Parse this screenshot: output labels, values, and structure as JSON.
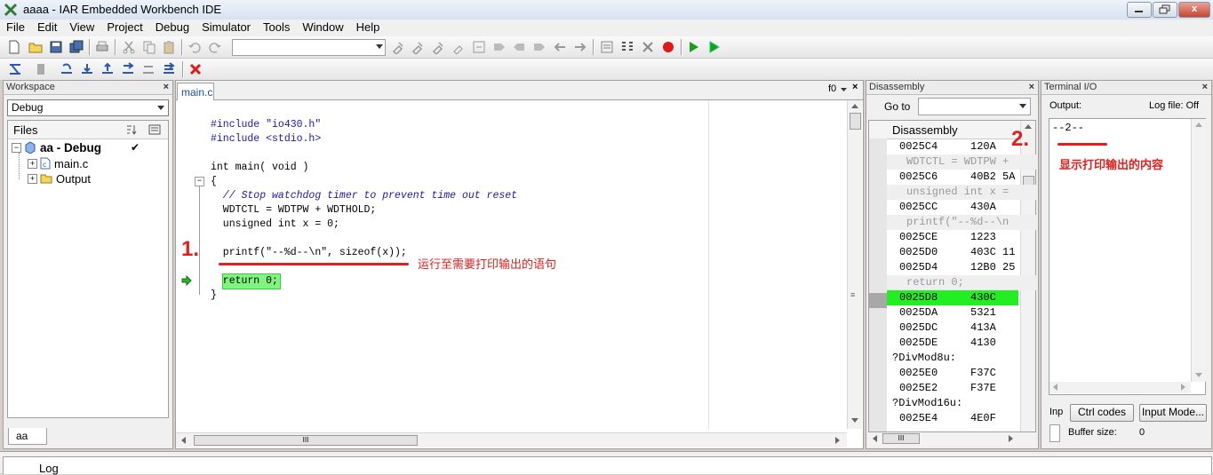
{
  "window": {
    "title": "aaaa - IAR Embedded Workbench IDE",
    "min_label": "",
    "max_label": "",
    "close_label": "x"
  },
  "menu": [
    "File",
    "Edit",
    "View",
    "Project",
    "Debug",
    "Simulator",
    "Tools",
    "Window",
    "Help"
  ],
  "workspace": {
    "header": "Workspace",
    "close": "×",
    "config": "Debug",
    "files_label": "Files",
    "project": "aa - Debug",
    "check": "✔",
    "file1": "main.c",
    "folder1": "Output",
    "bottom_tab": "aa"
  },
  "editor": {
    "tab": "main.c",
    "func_label": "f0",
    "code": [
      "#include \"io430.h\"",
      "#include <stdio.h>",
      "",
      "int main( void )",
      "{",
      "  // Stop watchdog timer to prevent time out reset",
      "  WDTCTL = WDTPW + WDTHOLD;",
      "  unsigned int x = 0;",
      "",
      "  printf(\"--%d--\\n\", sizeof(x));",
      "",
      "  return 0;",
      "}"
    ],
    "annotation1_num": "1.",
    "annotation1_text": "运行至需要打印输出的语句",
    "hscroll_thumb": "III"
  },
  "disassembly": {
    "header": "Disassembly",
    "goto_label": "Go to",
    "title": "Disassembly",
    "lines": [
      {
        "addr": "0025C4",
        "code": "120A",
        "type": "code"
      },
      {
        "text": "WDTCTL = WDTPW +",
        "type": "src"
      },
      {
        "addr": "0025C6",
        "code": "40B2 5A",
        "type": "code"
      },
      {
        "text": "unsigned int x =",
        "type": "src"
      },
      {
        "addr": "0025CC",
        "code": "430A",
        "type": "code"
      },
      {
        "text": "printf(\"--%d--\\n",
        "type": "src"
      },
      {
        "addr": "0025CE",
        "code": "1223",
        "type": "code"
      },
      {
        "addr": "0025D0",
        "code": "403C 11",
        "type": "code"
      },
      {
        "addr": "0025D4",
        "code": "12B0 25",
        "type": "code"
      },
      {
        "text": "return 0;",
        "type": "src"
      },
      {
        "addr": "0025D8",
        "code": "430C",
        "type": "cur"
      },
      {
        "addr": "0025DA",
        "code": "5321",
        "type": "code"
      },
      {
        "addr": "0025DC",
        "code": "413A",
        "type": "code"
      },
      {
        "addr": "0025DE",
        "code": "4130",
        "type": "code"
      },
      {
        "text": "?DivMod8u:",
        "type": "label"
      },
      {
        "addr": "0025E0",
        "code": "F37C",
        "type": "code"
      },
      {
        "addr": "0025E2",
        "code": "F37E",
        "type": "code"
      },
      {
        "text": "?DivMod16u:",
        "type": "label"
      },
      {
        "addr": "0025E4",
        "code": "4E0F",
        "type": "code"
      }
    ],
    "hscroll_thumb": "III",
    "annotation2_num": "2.",
    "annotation2_text": "显示打印输出的内容"
  },
  "terminal": {
    "header": "Terminal I/O",
    "output_label": "Output:",
    "logfile_label": "Log file:  Off",
    "output_text": "--2--",
    "input_label": "Inp",
    "ctrl_codes": "Ctrl codes",
    "input_mode": "Input Mode...",
    "buffer_label": "Buffer size:",
    "buffer_value": "0"
  },
  "log": {
    "label": "Log"
  },
  "colors": {
    "annotation_red": "#e0201c",
    "current_line_green": "#23ee23",
    "code_blue": "#1a1aa6"
  }
}
